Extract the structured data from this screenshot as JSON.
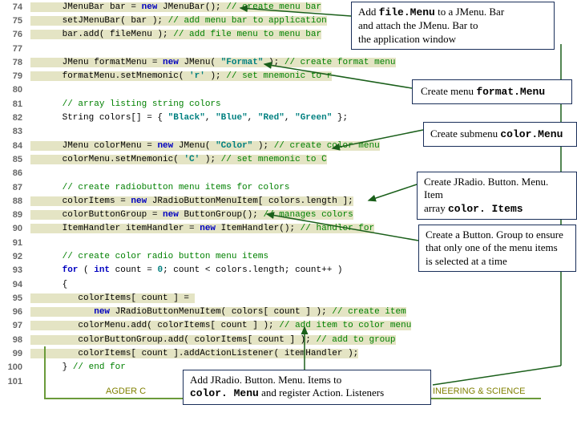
{
  "code": {
    "lines": [
      {
        "n": "74",
        "tokens": [
          {
            "t": "hl",
            "v": "      JMenuBar bar = "
          },
          {
            "t": "kw hl",
            "v": "new"
          },
          {
            "t": "hl",
            "v": " JMenuBar(); "
          },
          {
            "t": "cm hl",
            "v": "// create menu bar"
          }
        ]
      },
      {
        "n": "75",
        "tokens": [
          {
            "t": "hl",
            "v": "      setJMenuBar( bar ); "
          },
          {
            "t": "cm hl",
            "v": "// add menu bar to application"
          }
        ]
      },
      {
        "n": "76",
        "tokens": [
          {
            "t": "hl",
            "v": "      bar.add( fileMenu ); "
          },
          {
            "t": "cm hl",
            "v": "// add file menu to menu bar"
          }
        ]
      },
      {
        "n": "77",
        "tokens": []
      },
      {
        "n": "78",
        "tokens": [
          {
            "t": "hl",
            "v": "      JMenu formatMenu = "
          },
          {
            "t": "kw hl",
            "v": "new"
          },
          {
            "t": "hl",
            "v": " JMenu( "
          },
          {
            "t": "str hl",
            "v": "\"Format\""
          },
          {
            "t": "hl",
            "v": " ); "
          },
          {
            "t": "cm hl",
            "v": "// create format menu"
          }
        ]
      },
      {
        "n": "79",
        "tokens": [
          {
            "t": "hl",
            "v": "      formatMenu.setMnemonic( "
          },
          {
            "t": "str hl",
            "v": "'r'"
          },
          {
            "t": "hl",
            "v": " ); "
          },
          {
            "t": "cm hl",
            "v": "// set mnemonic to r"
          }
        ]
      },
      {
        "n": "80",
        "tokens": []
      },
      {
        "n": "81",
        "tokens": [
          {
            "t": "cm",
            "v": "      // array listing string colors"
          }
        ]
      },
      {
        "n": "82",
        "tokens": [
          {
            "t": "plain",
            "v": "      String colors[] = { "
          },
          {
            "t": "str",
            "v": "\"Black\""
          },
          {
            "t": "plain",
            "v": ", "
          },
          {
            "t": "str",
            "v": "\"Blue\""
          },
          {
            "t": "plain",
            "v": ", "
          },
          {
            "t": "str",
            "v": "\"Red\""
          },
          {
            "t": "plain",
            "v": ", "
          },
          {
            "t": "str",
            "v": "\"Green\""
          },
          {
            "t": "plain",
            "v": " };"
          }
        ]
      },
      {
        "n": "83",
        "tokens": []
      },
      {
        "n": "84",
        "tokens": [
          {
            "t": "hl",
            "v": "      JMenu colorMenu = "
          },
          {
            "t": "kw hl",
            "v": "new"
          },
          {
            "t": "hl",
            "v": " JMenu( "
          },
          {
            "t": "str hl",
            "v": "\"Color\""
          },
          {
            "t": "hl",
            "v": " ); "
          },
          {
            "t": "cm hl",
            "v": "// create color menu"
          }
        ]
      },
      {
        "n": "85",
        "tokens": [
          {
            "t": "hl",
            "v": "      colorMenu.setMnemonic( "
          },
          {
            "t": "str hl",
            "v": "'C'"
          },
          {
            "t": "hl",
            "v": " ); "
          },
          {
            "t": "cm hl",
            "v": "// set mnemonic to C"
          }
        ]
      },
      {
        "n": "86",
        "tokens": []
      },
      {
        "n": "87",
        "tokens": [
          {
            "t": "cm",
            "v": "      // create radiobutton menu items for colors"
          }
        ]
      },
      {
        "n": "88",
        "tokens": [
          {
            "t": "hl",
            "v": "      colorItems = "
          },
          {
            "t": "kw hl",
            "v": "new"
          },
          {
            "t": "hl",
            "v": " JRadioButtonMenuItem[ colors.length ];"
          }
        ]
      },
      {
        "n": "89",
        "tokens": [
          {
            "t": "hl",
            "v": "      colorButtonGroup = "
          },
          {
            "t": "kw hl",
            "v": "new"
          },
          {
            "t": "hl",
            "v": " ButtonGroup(); "
          },
          {
            "t": "cm hl",
            "v": "// manages colors"
          }
        ]
      },
      {
        "n": "90",
        "tokens": [
          {
            "t": "hl",
            "v": "      ItemHandler itemHandler = "
          },
          {
            "t": "kw hl",
            "v": "new"
          },
          {
            "t": "hl",
            "v": " ItemHandler(); "
          },
          {
            "t": "cm hl",
            "v": "// handler for"
          }
        ]
      },
      {
        "n": "91",
        "tokens": []
      },
      {
        "n": "92",
        "tokens": [
          {
            "t": "cm",
            "v": "      // create color radio button menu items"
          }
        ]
      },
      {
        "n": "93",
        "tokens": [
          {
            "t": "kw",
            "v": "      for"
          },
          {
            "t": "plain",
            "v": " ( "
          },
          {
            "t": "kw",
            "v": "int"
          },
          {
            "t": "plain",
            "v": " count = "
          },
          {
            "t": "str",
            "v": "0"
          },
          {
            "t": "plain",
            "v": "; count < colors.length; count++ )"
          }
        ]
      },
      {
        "n": "94",
        "tokens": [
          {
            "t": "plain",
            "v": "      {"
          }
        ]
      },
      {
        "n": "95",
        "tokens": [
          {
            "t": "hl",
            "v": "         colorItems[ count ] = "
          }
        ]
      },
      {
        "n": "96",
        "tokens": [
          {
            "t": "hl",
            "v": "            "
          },
          {
            "t": "kw hl",
            "v": "new"
          },
          {
            "t": "hl",
            "v": " JRadioButtonMenuItem( colors[ count ] ); "
          },
          {
            "t": "cm hl",
            "v": "// create item"
          }
        ]
      },
      {
        "n": "97",
        "tokens": [
          {
            "t": "hl",
            "v": "         colorMenu.add( colorItems[ count ] ); "
          },
          {
            "t": "cm hl",
            "v": "// add item to color menu"
          }
        ]
      },
      {
        "n": "98",
        "tokens": [
          {
            "t": "hl",
            "v": "         colorButtonGroup.add( colorItems[ count ] ); "
          },
          {
            "t": "cm hl",
            "v": "// add to group"
          }
        ]
      },
      {
        "n": "99",
        "tokens": [
          {
            "t": "hl",
            "v": "         colorItems[ count ].addActionListener( itemHandler );"
          }
        ]
      },
      {
        "n": "100",
        "tokens": [
          {
            "t": "plain",
            "v": "      } "
          },
          {
            "t": "cm",
            "v": "// end for"
          }
        ]
      },
      {
        "n": "101",
        "tokens": []
      }
    ]
  },
  "callouts": {
    "c1": {
      "parts": [
        {
          "t": "",
          "v": "Add "
        },
        {
          "t": "mono",
          "v": "file.Menu"
        },
        {
          "t": "",
          "v": " to a "
        },
        {
          "t": "b",
          "v": "JMenu. Bar"
        },
        {
          "t": "br",
          "v": ""
        },
        {
          "t": "",
          "v": " and attach the "
        },
        {
          "t": "b",
          "v": "JMenu. Bar"
        },
        {
          "t": "",
          "v": " to"
        },
        {
          "t": "br",
          "v": ""
        },
        {
          "t": "",
          "v": " the application window"
        }
      ]
    },
    "c2": {
      "parts": [
        {
          "t": "",
          "v": "Create menu "
        },
        {
          "t": "mono",
          "v": "format.Menu"
        }
      ]
    },
    "c3": {
      "parts": [
        {
          "t": "",
          "v": "Create submenu "
        },
        {
          "t": "mono",
          "v": "color.Menu"
        }
      ]
    },
    "c4": {
      "parts": [
        {
          "t": "",
          "v": "Create "
        },
        {
          "t": "b",
          "v": "JRadio. Button. Menu. Item"
        },
        {
          "t": "br",
          "v": ""
        },
        {
          "t": "",
          "v": " array "
        },
        {
          "t": "mono",
          "v": "color. Items"
        }
      ]
    },
    "c5": {
      "parts": [
        {
          "t": "",
          "v": "Create a "
        },
        {
          "t": "b",
          "v": "Button. Group"
        },
        {
          "t": "",
          "v": " to ensure"
        },
        {
          "t": "br",
          "v": ""
        },
        {
          "t": "",
          "v": " that only one of the menu items"
        },
        {
          "t": "br",
          "v": ""
        },
        {
          "t": "",
          "v": " is selected at a time"
        }
      ]
    },
    "c6": {
      "parts": [
        {
          "t": "",
          "v": "Add "
        },
        {
          "t": "b",
          "v": "JRadio. Button. Menu. Items"
        },
        {
          "t": "",
          "v": " to"
        },
        {
          "t": "br",
          "v": ""
        },
        {
          "t": "mono",
          "v": " color. Menu"
        },
        {
          "t": "",
          "v": " and register "
        },
        {
          "t": "b",
          "v": "Action. Listeners"
        }
      ]
    }
  },
  "footer": {
    "left": "AGDER C",
    "right": "INEERING & SCIENCE"
  }
}
